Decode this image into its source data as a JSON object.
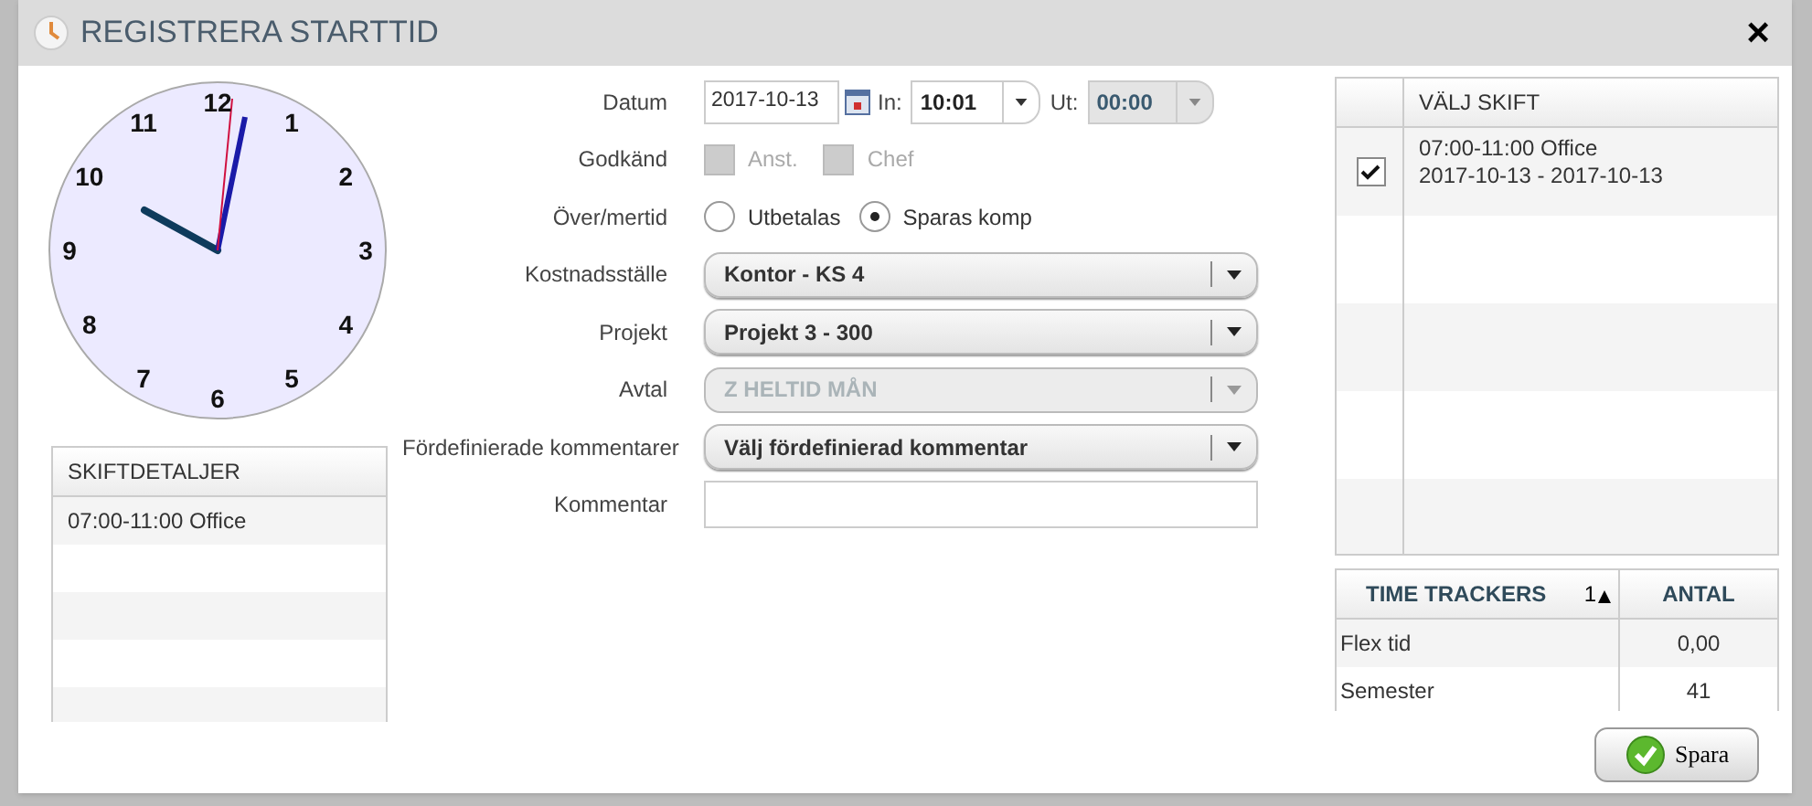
{
  "window": {
    "title": "REGISTRERA STARTTID",
    "close": "×"
  },
  "clock": {
    "numbers": [
      "12",
      "1",
      "2",
      "3",
      "4",
      "5",
      "6",
      "7",
      "8",
      "9",
      "10",
      "11"
    ]
  },
  "shift_details": {
    "header": "SKIFTDETALJER",
    "rows": [
      "07:00-11:00 Office"
    ]
  },
  "form": {
    "rows": [
      {
        "kind": "datetime",
        "label": "Datum",
        "date": "2017-10-13",
        "in_label": "In:",
        "in_value": "10:01",
        "out_label": "Ut:",
        "out_value": "00:00",
        "out_disabled": true
      },
      {
        "kind": "checkboxes",
        "label": "Godkänd",
        "options": [
          {
            "label": "Anst.",
            "checked": false,
            "disabled": true
          },
          {
            "label": "Chef",
            "checked": false,
            "disabled": true
          }
        ]
      },
      {
        "kind": "radios",
        "label": "Över/mertid",
        "options": [
          {
            "label": "Utbetalas",
            "selected": false
          },
          {
            "label": "Sparas komp",
            "selected": true
          }
        ]
      },
      {
        "kind": "select",
        "label": "Kostnadsställe",
        "value": "Kontor - KS 4",
        "disabled": false
      },
      {
        "kind": "select",
        "label": "Projekt",
        "value": "Projekt 3 - 300",
        "disabled": false
      },
      {
        "kind": "select",
        "label": "Avtal",
        "value": "Z HELTID MÅN",
        "disabled": true
      },
      {
        "kind": "select",
        "label": "Fördefinierade kommentarer",
        "value": "Välj fördefinierad kommentar",
        "disabled": false
      },
      {
        "kind": "text",
        "label": "Kommentar"
      }
    ]
  },
  "shift_select": {
    "header": "VÄLJ SKIFT",
    "rows": [
      {
        "line1": "07:00-11:00 Office",
        "line2": "2017-10-13 - 2017-10-13",
        "checked": true
      }
    ]
  },
  "time_trackers": {
    "columns": [
      "TIME TRACKERS",
      "1",
      "ANTAL"
    ],
    "rows": [
      [
        "Flex tid",
        "0,00"
      ],
      [
        "Semester",
        "41"
      ]
    ]
  },
  "save_button": "Spara"
}
